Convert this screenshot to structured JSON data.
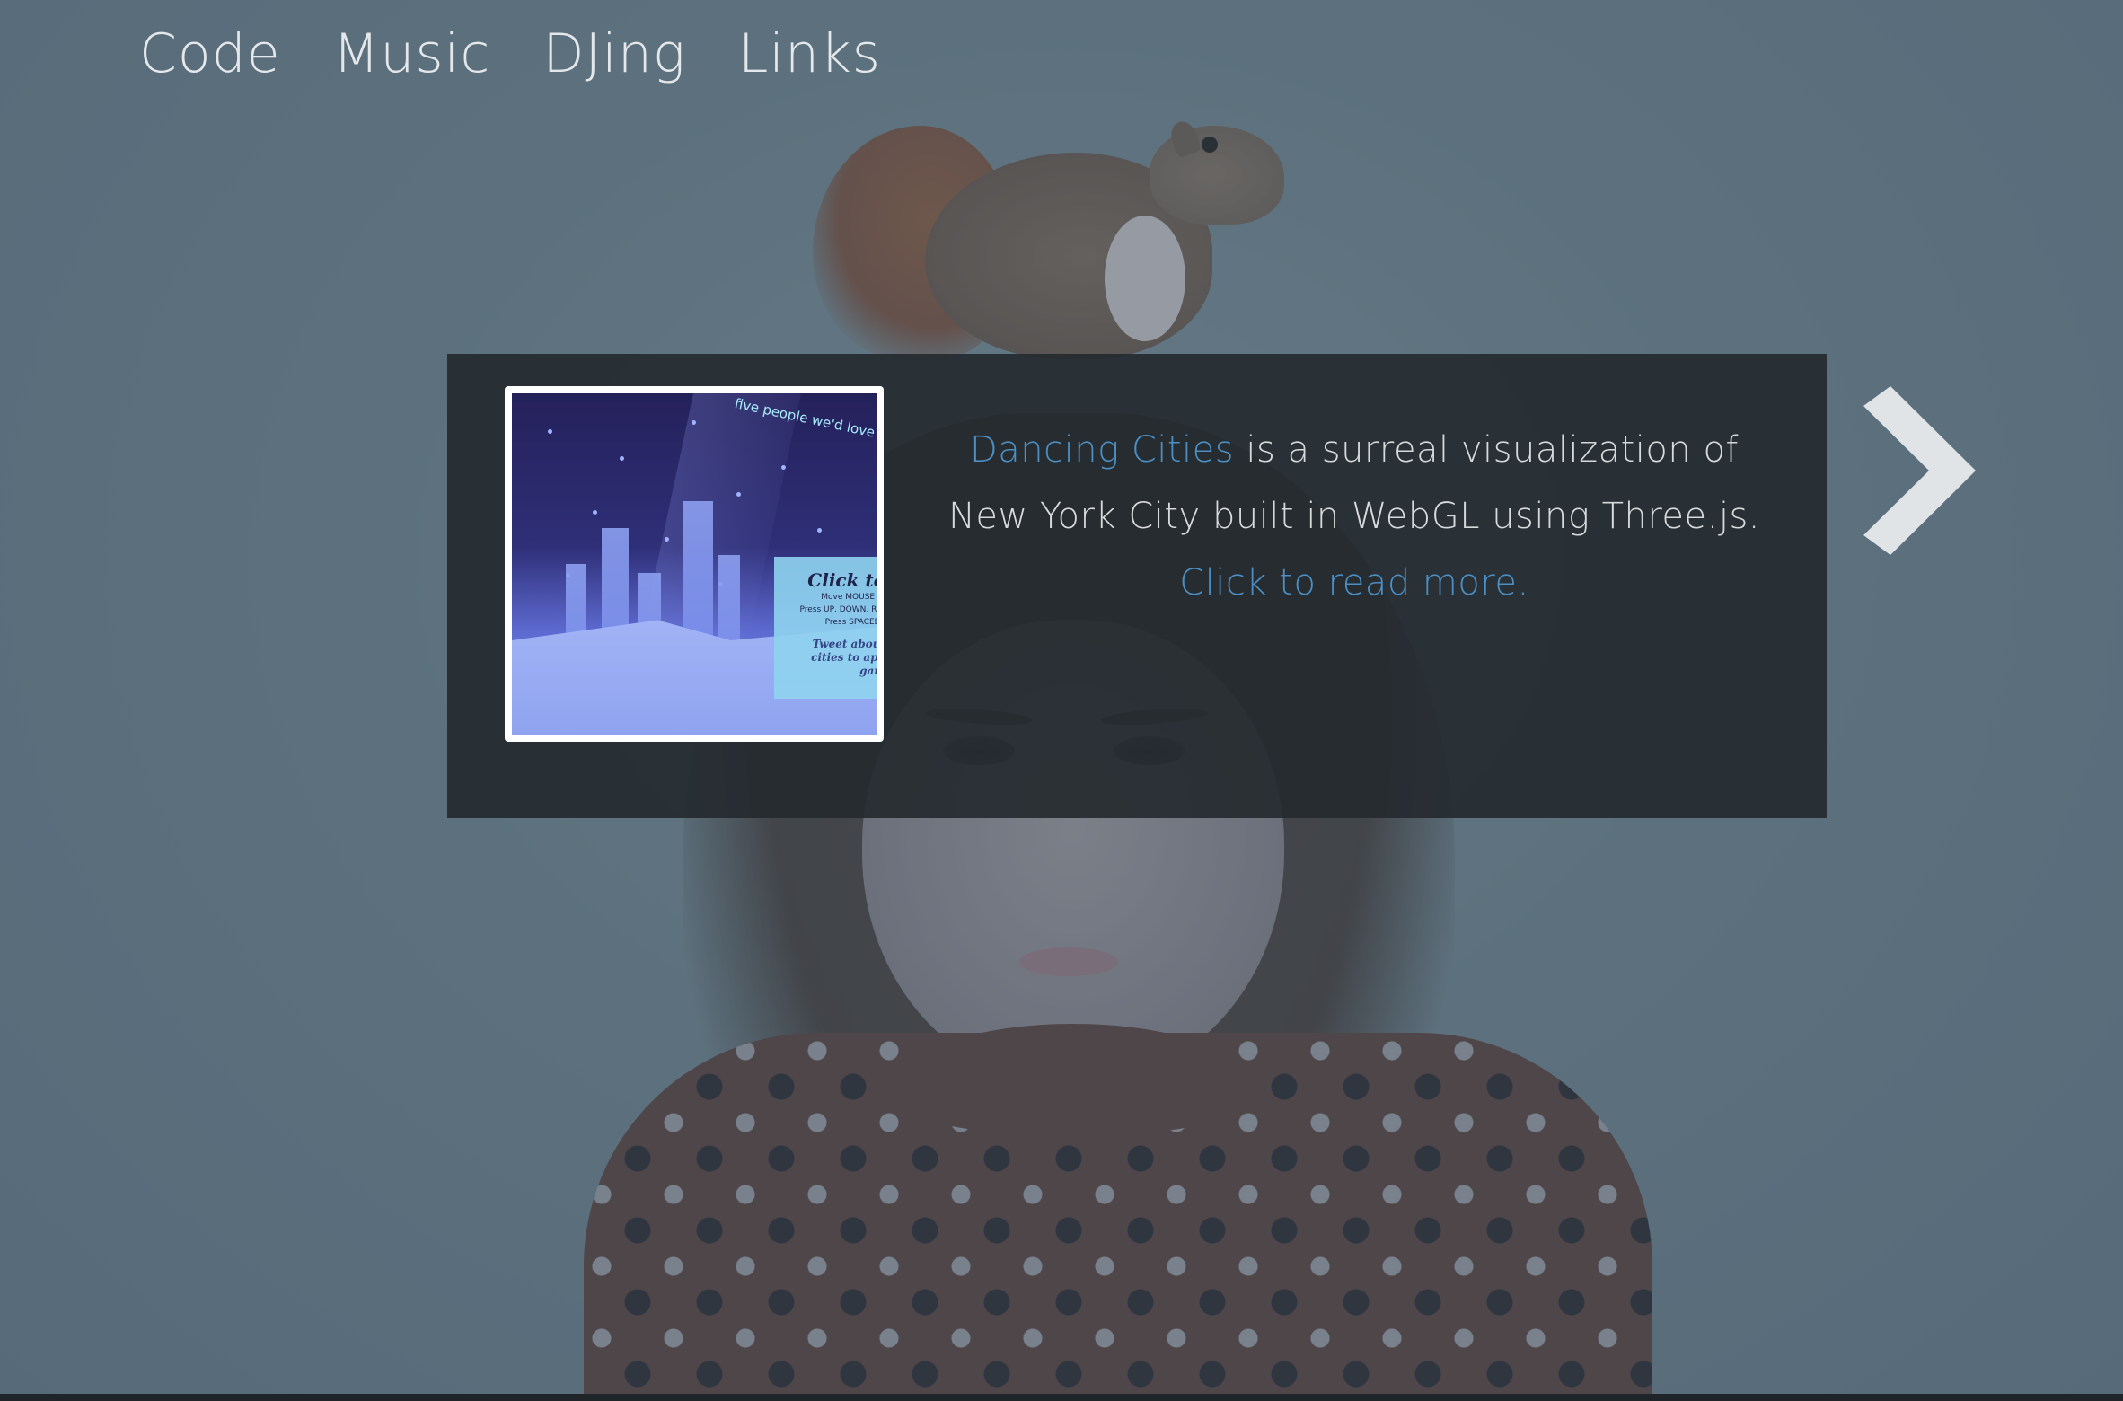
{
  "nav": {
    "items": [
      {
        "label": "Code"
      },
      {
        "label": "Music"
      },
      {
        "label": "DJing"
      },
      {
        "label": "Links"
      }
    ]
  },
  "feature": {
    "title_link": "Dancing Cities",
    "description": " is a surreal visualization of New York City built in WebGL using Three.js. ",
    "read_more_link": "Click to read more.",
    "thumbnail": {
      "banner_text": "five people we'd love to",
      "card_title": "Click to",
      "card_lines": [
        "Move MOUSE to",
        "Press UP, DOWN, RIG",
        "Press SPACEBA"
      ],
      "card_note_lines": [
        "Tweet about",
        "cities to app",
        "gam"
      ]
    }
  },
  "colors": {
    "link": "#4b8fc4",
    "text": "#d7dadb",
    "panel_bg": "#24292d",
    "nav_text": "#e4e8ea",
    "arrow": "#e1e4e6"
  },
  "icons": {
    "next": "chevron-right-icon"
  }
}
